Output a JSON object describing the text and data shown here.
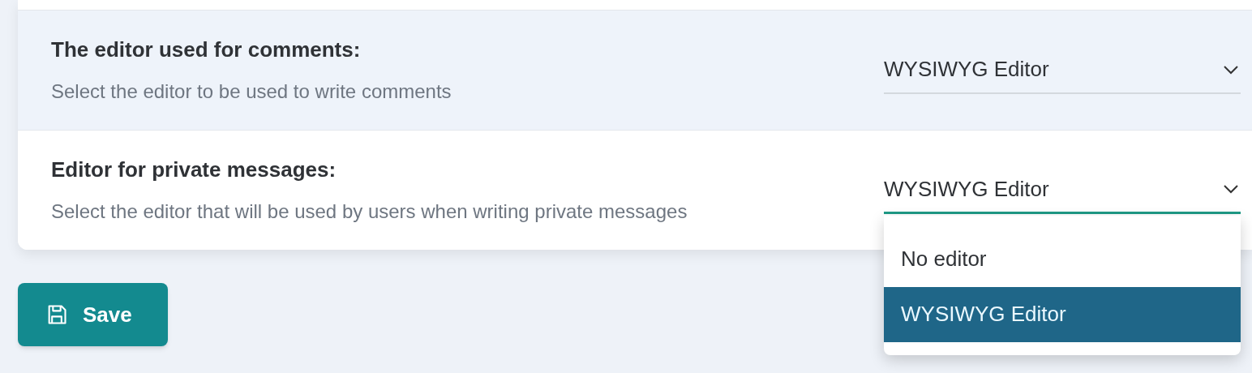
{
  "settings": [
    {
      "title": "The editor used for comments:",
      "description": "Select the editor to be used to write comments",
      "highlighted": true,
      "select": {
        "value": "WYSIWYG Editor",
        "focused": false
      }
    },
    {
      "title": "Editor for private messages:",
      "description": "Select the editor that will be used by users when writing private messages",
      "highlighted": false,
      "select": {
        "value": "WYSIWYG Editor",
        "focused": true,
        "expanded": true,
        "options": [
          {
            "label": "No editor",
            "selected": false
          },
          {
            "label": "WYSIWYG Editor",
            "selected": true
          }
        ]
      }
    }
  ],
  "save_button": {
    "label": "Save"
  }
}
